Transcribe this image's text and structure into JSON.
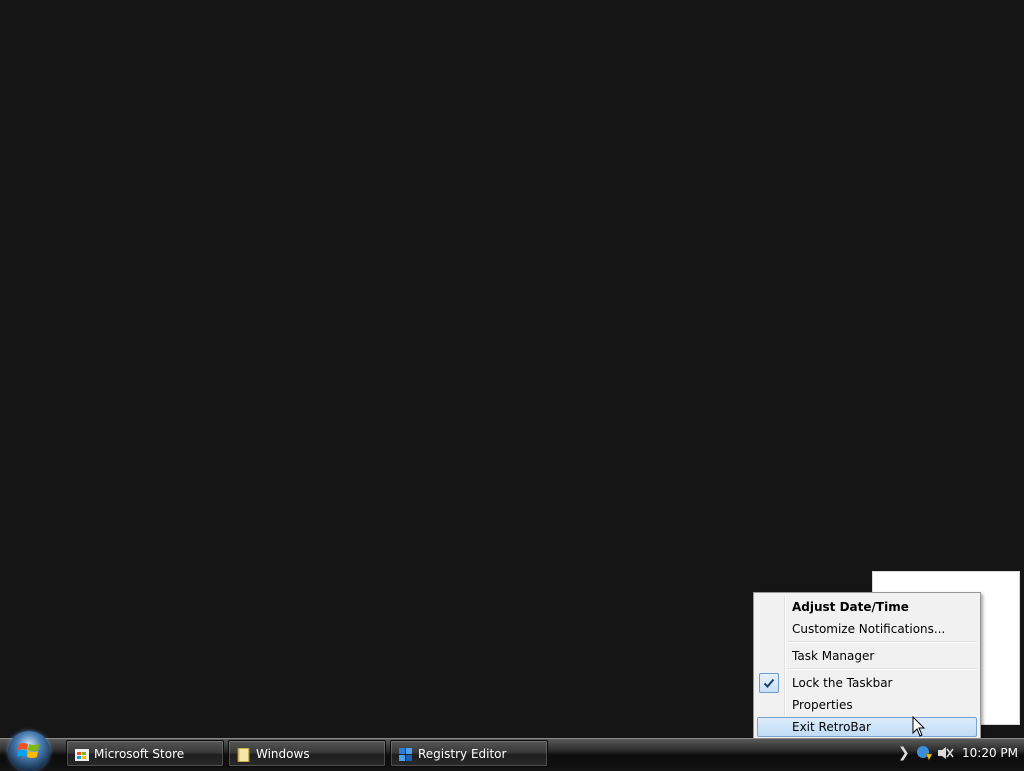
{
  "context_menu": {
    "items": [
      {
        "label": "Adjust Date/Time",
        "bold": true
      },
      {
        "label": "Customize Notifications..."
      },
      {
        "label": "Task Manager"
      },
      {
        "label": "Lock the Taskbar",
        "checked": true
      },
      {
        "label": "Properties"
      },
      {
        "label": "Exit RetroBar",
        "highlighted": true
      }
    ]
  },
  "taskbar": {
    "buttons": [
      {
        "label": "Microsoft Store",
        "icon": "microsoft-store-icon"
      },
      {
        "label": "Windows",
        "icon": "folder-icon"
      },
      {
        "label": "Registry Editor",
        "icon": "registry-editor-icon"
      }
    ],
    "tray_icons": [
      "chevron-right-icon",
      "network-warning-icon",
      "volume-muted-icon"
    ],
    "clock": "10:20 PM"
  },
  "colors": {
    "desktop": "#151515",
    "menu_highlight": "#c1dcf6",
    "menu_highlight_border": "#7da2ce"
  }
}
